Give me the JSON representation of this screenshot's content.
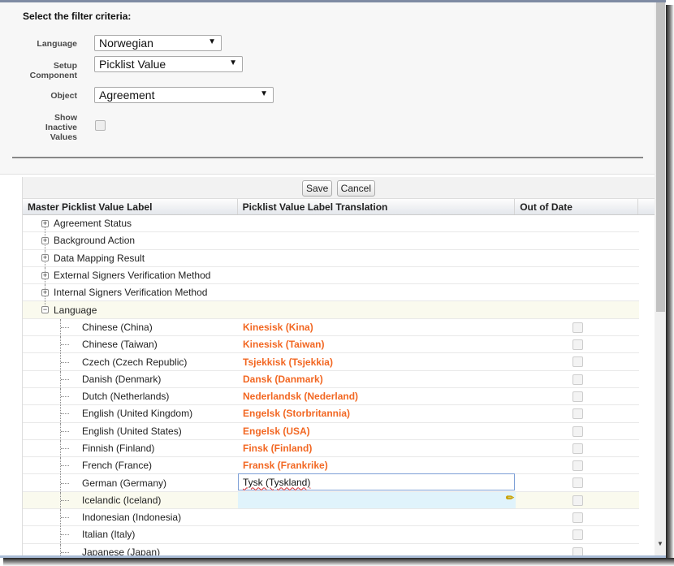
{
  "filters": {
    "title": "Select the filter criteria:",
    "language_label": "Language",
    "language_value": "Norwegian",
    "component_label": "Setup Component",
    "component_value": "Picklist Value",
    "object_label": "Object",
    "object_value": "Agreement",
    "inactive_label": "Show Inactive Values",
    "inactive_checked": false
  },
  "toolbar": {
    "save": "Save",
    "cancel": "Cancel"
  },
  "columns": [
    "Master Picklist Value Label",
    "Picklist Value Label Translation",
    "Out of Date"
  ],
  "groups": [
    "Agreement Status",
    "Background Action",
    "Data Mapping Result",
    "External Signers Verification Method",
    "Internal Signers Verification Method",
    "Language"
  ],
  "rows": [
    {
      "label": "Chinese (China)",
      "translation": "Kinesisk (Kina)"
    },
    {
      "label": "Chinese (Taiwan)",
      "translation": "Kinesisk (Taiwan)"
    },
    {
      "label": "Czech (Czech Republic)",
      "translation": "Tsjekkisk (Tsjekkia)"
    },
    {
      "label": "Danish (Denmark)",
      "translation": "Dansk (Danmark)"
    },
    {
      "label": "Dutch (Netherlands)",
      "translation": "Nederlandsk (Nederland)"
    },
    {
      "label": "English (United Kingdom)",
      "translation": "Engelsk (Storbritannia)"
    },
    {
      "label": "English (United States)",
      "translation": "Engelsk (USA)"
    },
    {
      "label": "Finnish (Finland)",
      "translation": "Finsk (Finland)"
    },
    {
      "label": "French (France)",
      "translation": "Fransk (Frankrike)"
    },
    {
      "label": "German (Germany)",
      "translation": "Tysk (Tyskland)"
    },
    {
      "label": "Icelandic (Iceland)",
      "translation": ""
    },
    {
      "label": "Indonesian (Indonesia)",
      "translation": ""
    },
    {
      "label": "Italian (Italy)",
      "translation": ""
    },
    {
      "label": "Japanese (Japan)",
      "translation": ""
    }
  ],
  "colors": {
    "translation": "#f26722",
    "highlight": "#e0f3fb"
  }
}
